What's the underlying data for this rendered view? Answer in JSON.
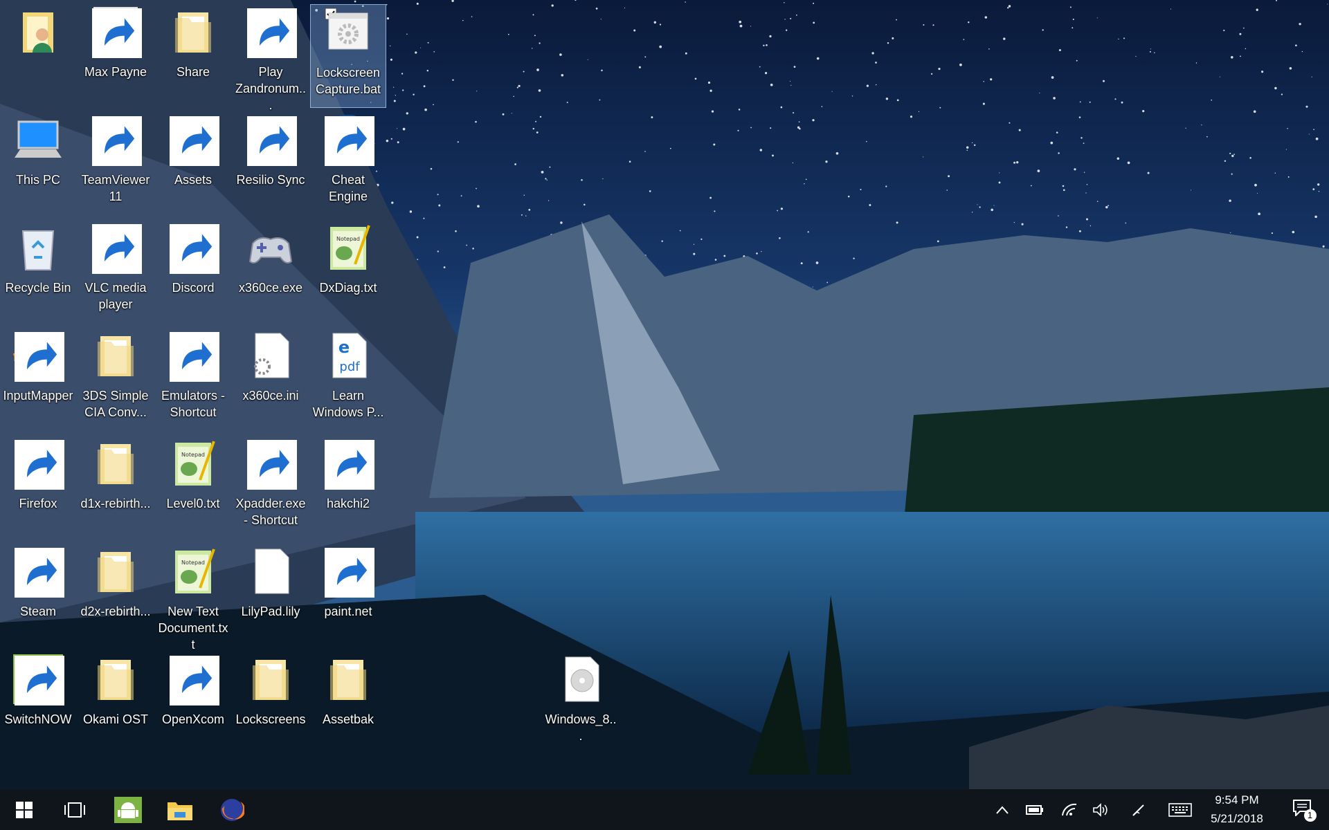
{
  "desktop": {
    "icons": [
      {
        "id": "user",
        "label": "",
        "col": 0,
        "row": 0,
        "type": "user-folder",
        "shortcut": false
      },
      {
        "id": "max-payne",
        "label": "Max Payne",
        "col": 1,
        "row": 0,
        "type": "game",
        "shortcut": true
      },
      {
        "id": "share",
        "label": "Share",
        "col": 2,
        "row": 0,
        "type": "folder",
        "shortcut": false
      },
      {
        "id": "play-zandronum",
        "label": "Play Zandronum...",
        "col": 3,
        "row": 0,
        "type": "game2",
        "shortcut": true
      },
      {
        "id": "lockscreen-capture",
        "label": "Lockscreen Capture.bat",
        "col": 4,
        "row": 0,
        "type": "bat",
        "shortcut": false,
        "selected": true
      },
      {
        "id": "this-pc",
        "label": "This PC",
        "col": 0,
        "row": 1,
        "type": "pc",
        "shortcut": false
      },
      {
        "id": "teamviewer",
        "label": "TeamViewer 11",
        "col": 1,
        "row": 1,
        "type": "teamviewer",
        "shortcut": true
      },
      {
        "id": "assets",
        "label": "Assets",
        "col": 2,
        "row": 1,
        "type": "folder",
        "shortcut": true
      },
      {
        "id": "resilio",
        "label": "Resilio Sync",
        "col": 3,
        "row": 1,
        "type": "sync",
        "shortcut": true
      },
      {
        "id": "cheat-engine",
        "label": "Cheat Engine",
        "col": 4,
        "row": 1,
        "type": "cheat",
        "shortcut": true
      },
      {
        "id": "recycle-bin",
        "label": "Recycle Bin",
        "col": 0,
        "row": 2,
        "type": "recycle",
        "shortcut": false
      },
      {
        "id": "vlc",
        "label": "VLC media player",
        "col": 1,
        "row": 2,
        "type": "vlc",
        "shortcut": true
      },
      {
        "id": "discord",
        "label": "Discord",
        "col": 2,
        "row": 2,
        "type": "discord",
        "shortcut": true
      },
      {
        "id": "x360ce-exe",
        "label": "x360ce.exe",
        "col": 3,
        "row": 2,
        "type": "gamepad",
        "shortcut": false
      },
      {
        "id": "dxdiag",
        "label": "DxDiag.txt",
        "col": 4,
        "row": 2,
        "type": "notepad",
        "shortcut": false
      },
      {
        "id": "inputmapper",
        "label": "InputMapper",
        "col": 0,
        "row": 3,
        "type": "mapper",
        "shortcut": true
      },
      {
        "id": "3ds",
        "label": "3DS Simple CIA Conv...",
        "col": 1,
        "row": 3,
        "type": "folder",
        "shortcut": false
      },
      {
        "id": "emulators",
        "label": "Emulators - Shortcut",
        "col": 2,
        "row": 3,
        "type": "folder",
        "shortcut": true
      },
      {
        "id": "x360ce-ini",
        "label": "x360ce.ini",
        "col": 3,
        "row": 3,
        "type": "ini",
        "shortcut": false
      },
      {
        "id": "learn-windows",
        "label": "Learn Windows P...",
        "col": 4,
        "row": 3,
        "type": "pdf",
        "shortcut": false
      },
      {
        "id": "firefox",
        "label": "Firefox",
        "col": 0,
        "row": 4,
        "type": "firefox",
        "shortcut": true
      },
      {
        "id": "d1x",
        "label": "d1x-rebirth...",
        "col": 1,
        "row": 4,
        "type": "folder",
        "shortcut": false
      },
      {
        "id": "level0",
        "label": "Level0.txt",
        "col": 2,
        "row": 4,
        "type": "notepad",
        "shortcut": false
      },
      {
        "id": "xpadder",
        "label": "Xpadder.exe - Shortcut",
        "col": 3,
        "row": 4,
        "type": "xpadder",
        "shortcut": true
      },
      {
        "id": "hakchi2",
        "label": "hakchi2",
        "col": 4,
        "row": 4,
        "type": "nes",
        "shortcut": true
      },
      {
        "id": "steam",
        "label": "Steam",
        "col": 0,
        "row": 5,
        "type": "steam",
        "shortcut": true
      },
      {
        "id": "d2x",
        "label": "d2x-rebirth...",
        "col": 1,
        "row": 5,
        "type": "folder",
        "shortcut": false
      },
      {
        "id": "new-text",
        "label": "New Text Document.txt",
        "col": 2,
        "row": 5,
        "type": "notepad",
        "shortcut": false
      },
      {
        "id": "lilypad",
        "label": "LilyPad.lily",
        "col": 3,
        "row": 5,
        "type": "blank",
        "shortcut": false
      },
      {
        "id": "paint-net",
        "label": "paint.net",
        "col": 4,
        "row": 5,
        "type": "paint",
        "shortcut": true
      },
      {
        "id": "switchnow",
        "label": "SwitchNOW",
        "col": 0,
        "row": 6,
        "type": "android",
        "shortcut": true
      },
      {
        "id": "okami",
        "label": "Okami OST",
        "col": 1,
        "row": 6,
        "type": "folder",
        "shortcut": false
      },
      {
        "id": "openxcom",
        "label": "OpenXcom",
        "col": 2,
        "row": 6,
        "type": "alien",
        "shortcut": true
      },
      {
        "id": "lockscreens",
        "label": "Lockscreens",
        "col": 3,
        "row": 6,
        "type": "folder",
        "shortcut": false
      },
      {
        "id": "assetbak",
        "label": "Assetbak",
        "col": 4,
        "row": 6,
        "type": "folder",
        "shortcut": false
      },
      {
        "id": "windows-8",
        "label": "Windows_8...",
        "col": 7,
        "row": 6,
        "type": "disc",
        "shortcut": false
      }
    ]
  },
  "taskbar": {
    "buttons": [
      {
        "name": "start-button",
        "icon": "windows-logo-icon"
      },
      {
        "name": "task-view-button",
        "icon": "task-view-icon"
      },
      {
        "name": "android-taskbar-button",
        "icon": "android-icon"
      },
      {
        "name": "file-explorer-taskbar-button",
        "icon": "folder-icon"
      },
      {
        "name": "firefox-taskbar-button",
        "icon": "firefox-icon"
      }
    ],
    "tray": [
      "chevron-up-icon",
      "battery-icon",
      "wifi-icon",
      "volume-icon",
      "pen-icon",
      "keyboard-icon"
    ],
    "clock": {
      "time": "9:54 PM",
      "date": "5/21/2018"
    },
    "notifications": {
      "count": "1"
    }
  },
  "colors": {
    "taskbar": "#10151c",
    "selection": "#8cb4e6",
    "folder": "#f2d67a"
  }
}
